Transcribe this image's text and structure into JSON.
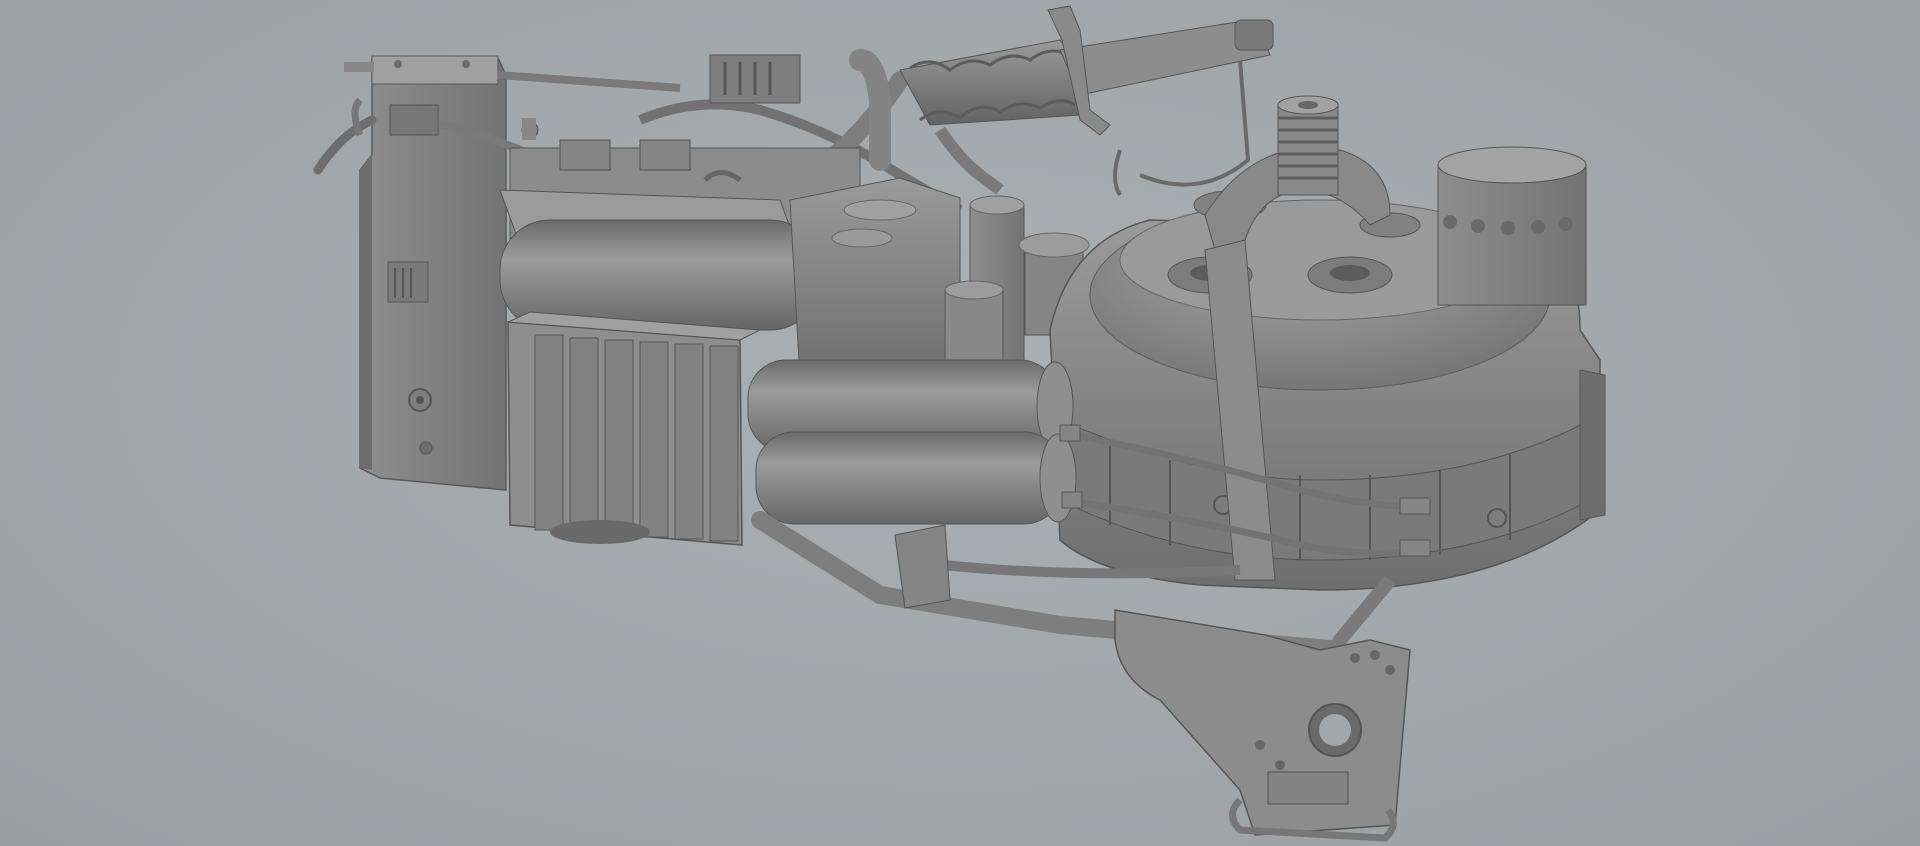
{
  "scene": {
    "subject": "proton-pack-3d-model",
    "render_style": "untextured-clay-render",
    "colors": {
      "background": "#a3a8ab",
      "model_base": "#8a8a8a",
      "model_highlight": "#a8a8a8",
      "model_shadow": "#5e5e5e",
      "model_dark": "#4a4a4a"
    }
  }
}
